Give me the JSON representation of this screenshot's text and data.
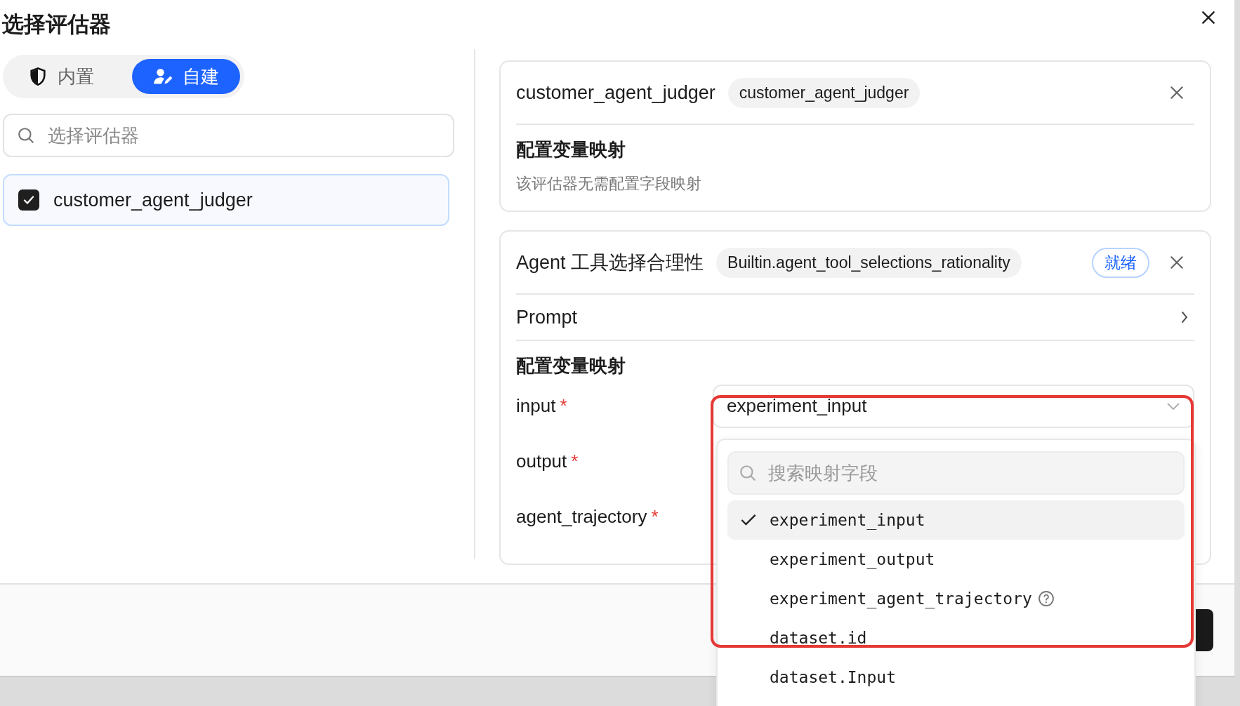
{
  "dialog": {
    "title": "选择评估器"
  },
  "tabs": [
    {
      "label": "内置",
      "selected": false,
      "kind": "shield"
    },
    {
      "label": "自建",
      "selected": true,
      "kind": "user"
    }
  ],
  "search": {
    "placeholder": "选择评估器"
  },
  "evaluators": [
    {
      "name": "customer_agent_judger",
      "checked": true,
      "selected": true
    }
  ],
  "cards": [
    {
      "kind": "note",
      "title": "customer_agent_judger",
      "tag": "customer_agent_judger",
      "section_title": "配置变量映射",
      "note": "该评估器无需配置字段映射"
    },
    {
      "kind": "mapping",
      "title": "Agent 工具选择合理性",
      "tag": "Builtin.agent_tool_selections_rationality",
      "status": "就绪",
      "prompt": "Prompt",
      "section_title": "配置变量映射",
      "mappings": [
        {
          "label": "input",
          "required_mark": "*",
          "value": "experiment_input"
        },
        {
          "label": "output",
          "required_mark": "*"
        },
        {
          "label": "agent_trajectory",
          "required_mark": "*"
        }
      ]
    }
  ],
  "dropdown": {
    "placeholder": "搜索映射字段",
    "options": [
      {
        "label": "experiment_input",
        "selected": true
      },
      {
        "label": "experiment_output",
        "selected": false
      },
      {
        "label": "experiment_agent_trajectory",
        "selected": false,
        "help": true
      },
      {
        "label": "dataset.id",
        "selected": false
      },
      {
        "label": "dataset.Input",
        "selected": false
      }
    ]
  }
}
